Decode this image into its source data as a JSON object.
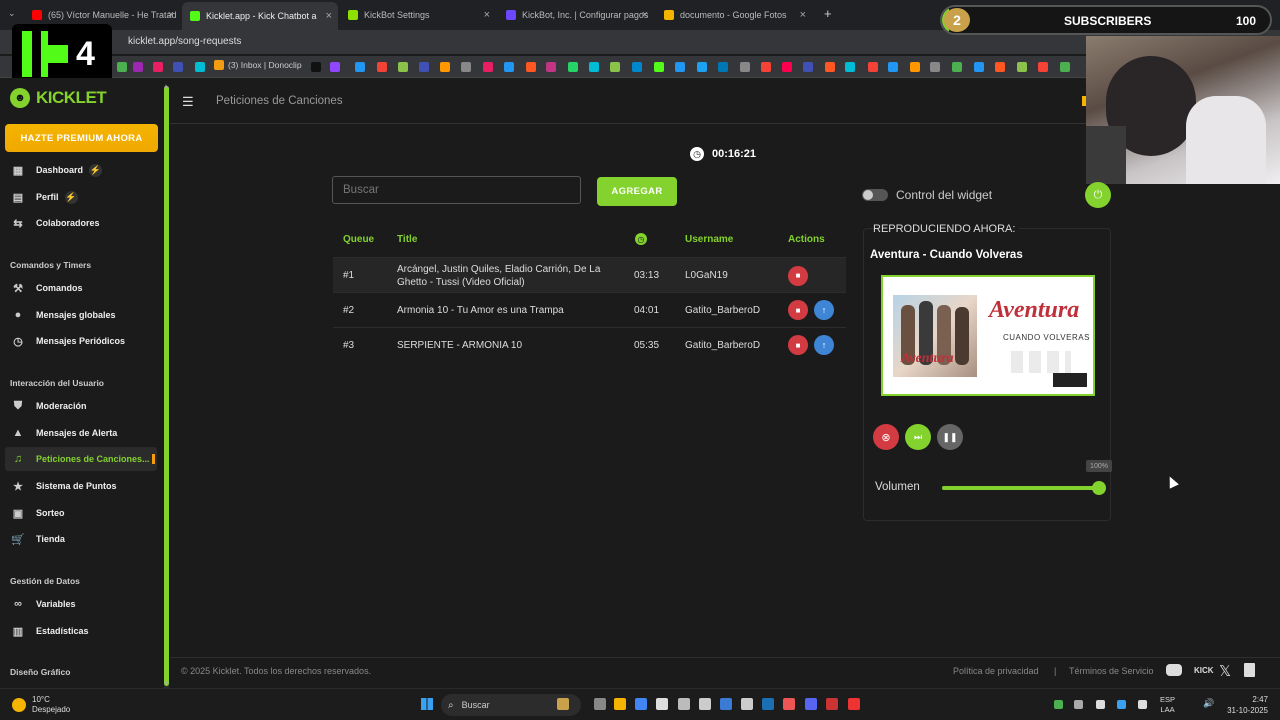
{
  "browser": {
    "tabs": [
      {
        "label": "(65) Víctor Manuelle - He Tratad",
        "color": "#ff0000"
      },
      {
        "label": "Kicklet.app - Kick Chatbot a",
        "color": "#53fc18"
      },
      {
        "label": "KickBot Settings",
        "color": "#8ee000"
      },
      {
        "label": "KickBot, Inc. | Configurar pagos",
        "color": "#6b48ff"
      },
      {
        "label": "documento - Google Fotos",
        "color": "#f4b400"
      }
    ],
    "new_tab": "+",
    "url": "kicklet.app/song-requests",
    "bookmark_text": "(3) Inbox | Donoclip"
  },
  "overlay": {
    "logo_number": "4",
    "sub_count": "2",
    "sub_label": "SUBSCRIBERS",
    "sub_goal": "100",
    "sub_progress": 0.02
  },
  "sidebar": {
    "brand": "KICKLET",
    "premium": "HAZTE PREMIUM AHORA",
    "items": [
      {
        "label": "Dashboard",
        "icon": "dashboard-icon",
        "glyph": "▦"
      },
      {
        "label": "Perfil",
        "icon": "profile-icon",
        "glyph": "▤"
      },
      {
        "label": "Colaboradores",
        "icon": "collab-icon",
        "glyph": "⇆"
      }
    ],
    "sec1": "Comandos y Timers",
    "items2": [
      {
        "label": "Comandos",
        "icon": "hammer-icon",
        "glyph": "⚒"
      },
      {
        "label": "Mensajes globales",
        "icon": "chat-icon",
        "glyph": "●"
      },
      {
        "label": "Mensajes Periódicos",
        "icon": "clock-icon",
        "glyph": "◷"
      }
    ],
    "sec2": "Interacción del Usuario",
    "items3": [
      {
        "label": "Moderación",
        "icon": "shield-icon",
        "glyph": "⛊"
      },
      {
        "label": "Mensajes de Alerta",
        "icon": "alert-icon",
        "glyph": "▲"
      },
      {
        "label": "Peticiones de Canciones...",
        "icon": "music-icon",
        "glyph": "♫"
      },
      {
        "label": "Sistema de Puntos",
        "icon": "star-icon",
        "glyph": "★"
      },
      {
        "label": "Sorteo",
        "icon": "gift-icon",
        "glyph": "▣"
      },
      {
        "label": "Tienda",
        "icon": "cart-icon",
        "glyph": "🛒"
      }
    ],
    "sec3": "Gestión de Datos",
    "items4": [
      {
        "label": "Variables",
        "icon": "link-icon",
        "glyph": "∞"
      },
      {
        "label": "Estadísticas",
        "icon": "chart-icon",
        "glyph": "▥"
      }
    ],
    "sec4": "Diseño Gráfico"
  },
  "main": {
    "page_title": "Peticiones de Canciones",
    "timer": "00:16:21",
    "search_placeholder": "Buscar",
    "add_button": "AGREGAR",
    "table": {
      "headers": [
        "Queue",
        "Title",
        "Username",
        "Actions"
      ],
      "rows": [
        {
          "queue": "#1",
          "title": "Arcángel, Justin Quiles, Eladio Carrión, De La Ghetto - Tussi (Video Oficial)",
          "duration": "03:13",
          "username": "L0GaN19"
        },
        {
          "queue": "#2",
          "title": "Armonia 10 - Tu Amor es una Trampa",
          "duration": "04:01",
          "username": "Gatito_BarberoD"
        },
        {
          "queue": "#3",
          "title": "SERPIENTE - ARMONIA 10",
          "duration": "05:35",
          "username": "Gatito_BarberoD"
        }
      ]
    },
    "widget": {
      "control_label": "Control del widget",
      "now_playing_label": "REPRODUCIENDO AHORA:",
      "song": "Aventura - Cuando Volveras",
      "cover_brand": "Aventura",
      "cover_subtitle": "CUANDO VOLVERAS",
      "volume_label": "Volumen",
      "volume_value": "100%",
      "volume_level": 1.0
    },
    "footer": {
      "copyright": "© 2025 Kicklet. Todos los derechos reservados.",
      "privacy": "Política de privacidad",
      "sep": "|",
      "terms": "Términos de Servicio"
    }
  },
  "taskbar": {
    "weather_temp": "10°C",
    "weather_desc": "Despejado",
    "search": "Buscar",
    "lang1": "ESP",
    "lang2": "LAA",
    "time": "2:47",
    "date": "31-10-2025"
  }
}
